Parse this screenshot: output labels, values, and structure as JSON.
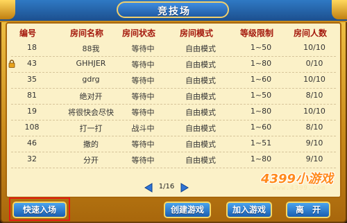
{
  "window": {
    "title": "竞技场"
  },
  "table": {
    "headers": {
      "id": "编号",
      "name": "房间名称",
      "status": "房间状态",
      "mode": "房间模式",
      "level": "等级限制",
      "count": "房间人数"
    },
    "rows": [
      {
        "id": "18",
        "name": "88我",
        "status": "等待中",
        "mode": "自由模式",
        "level": "1~50",
        "count": "10/10",
        "locked": false
      },
      {
        "id": "43",
        "name": "GHHJER",
        "status": "等待中",
        "mode": "自由模式",
        "level": "1~80",
        "count": "0/10",
        "locked": true
      },
      {
        "id": "35",
        "name": "gdrg",
        "status": "等待中",
        "mode": "自由模式",
        "level": "1~60",
        "count": "10/10",
        "locked": false
      },
      {
        "id": "81",
        "name": "绝对开",
        "status": "等待中",
        "mode": "自由模式",
        "level": "1~50",
        "count": "8/10",
        "locked": false
      },
      {
        "id": "19",
        "name": "将很快会尽快",
        "status": "等待中",
        "mode": "自由模式",
        "level": "1~80",
        "count": "10/10",
        "locked": false
      },
      {
        "id": "108",
        "name": "打一打",
        "status": "战斗中",
        "mode": "自由模式",
        "level": "1~60",
        "count": "8/10",
        "locked": false
      },
      {
        "id": "46",
        "name": "撒的",
        "status": "等待中",
        "mode": "自由模式",
        "level": "1~51",
        "count": "9/10",
        "locked": false
      },
      {
        "id": "32",
        "name": "分开",
        "status": "等待中",
        "mode": "自由模式",
        "level": "1~80",
        "count": "9/10",
        "locked": false
      }
    ]
  },
  "pager": {
    "text": "1/16"
  },
  "buttons": {
    "quick_join": "快速入场",
    "create": "创建游戏",
    "join": "加入游戏",
    "leave": "离　开"
  },
  "watermark": {
    "main": "4399小游戏",
    "sub": "www.4399.com"
  },
  "icons": {
    "lock": "lock-icon",
    "prev": "arrow-left-icon",
    "next": "arrow-right-icon"
  },
  "colors": {
    "header_text": "#a4190d",
    "button_blue": "#1b5fb0",
    "frame_gold": "#c98a1a",
    "highlight_red": "#e21d12"
  }
}
